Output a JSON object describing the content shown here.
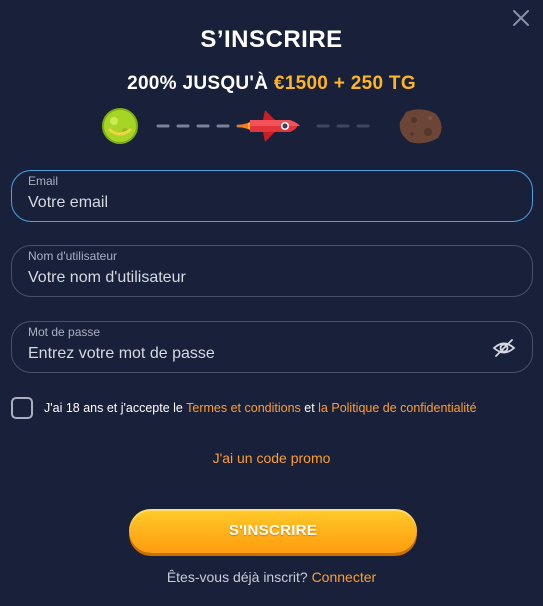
{
  "modal": {
    "title": "S’INSCRIRE",
    "bonus_prefix": "200% JUSQU'À ",
    "bonus_highlight": "€1500 + 250 TG"
  },
  "form": {
    "email": {
      "label": "Email",
      "placeholder": "Votre email",
      "value": ""
    },
    "username": {
      "label": "Nom d'utilisateur",
      "placeholder": "Votre nom d'utilisateur",
      "value": ""
    },
    "password": {
      "label": "Mot de passe",
      "placeholder": "Entrez votre mot de passe",
      "value": ""
    }
  },
  "terms": {
    "prefix": "J'ai 18 ans et j'accepte le ",
    "terms_link": "Termes et conditions",
    "middle": " et ",
    "privacy_link": "la Politique de confidentialité",
    "checked": false
  },
  "promo_link": "J'ai un code promo",
  "submit_label": "S'INSCRIRE",
  "login": {
    "prompt": "Êtes-vous déjà inscrit? ",
    "link": "Connecter"
  },
  "colors": {
    "background": "#18203a",
    "accent": "#ff9e2c",
    "button": "#ffb01a",
    "focus_border": "#4aa3df"
  },
  "icons": [
    "close-icon",
    "eye-slash-icon",
    "planet-green-icon",
    "rocket-icon",
    "asteroid-icon"
  ]
}
